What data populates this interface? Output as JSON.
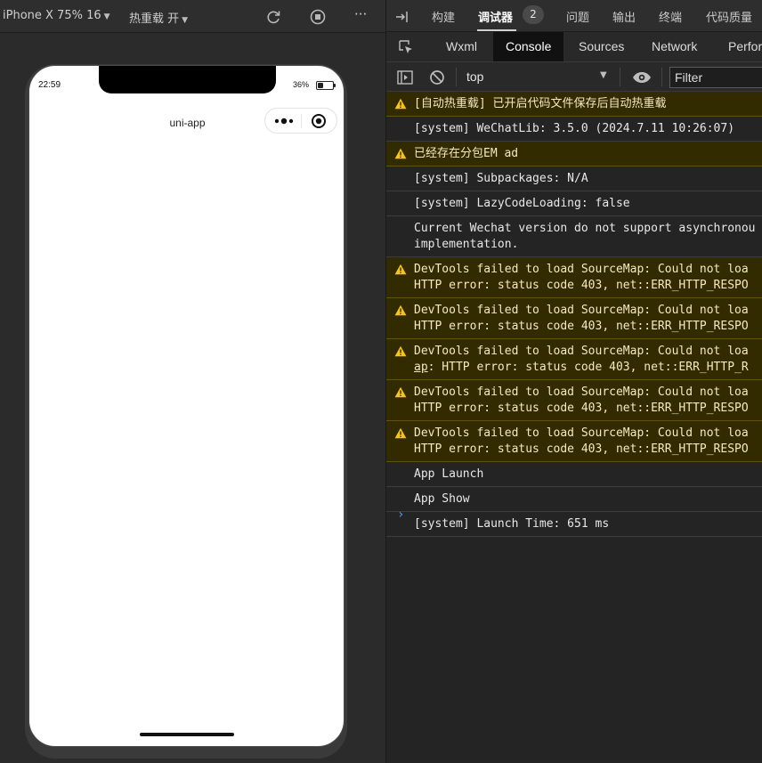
{
  "simulator": {
    "device_label": "iPhone X 75% 16",
    "hot_reload_label": "热重载 开",
    "toolbar_icons": [
      "refresh-icon",
      "stop-icon",
      "more-icon"
    ],
    "more_label": "···",
    "phone": {
      "time": "22:59",
      "battery_percent_text": "36%",
      "battery_level": 0.36,
      "nav_title": "uni-app"
    }
  },
  "devtools": {
    "top_tabs": [
      {
        "label": "构建",
        "active": false
      },
      {
        "label": "调试器",
        "active": true
      },
      {
        "label": "问题",
        "active": false
      },
      {
        "label": "输出",
        "active": false
      },
      {
        "label": "终端",
        "active": false
      },
      {
        "label": "代码质量",
        "active": false
      }
    ],
    "debugger_badge": "2",
    "panel_tabs": [
      {
        "label": "Wxml",
        "active": false
      },
      {
        "label": "Console",
        "active": true
      },
      {
        "label": "Sources",
        "active": false
      },
      {
        "label": "Network",
        "active": false
      },
      {
        "label": "Perfor",
        "active": false
      }
    ],
    "console_toolbar": {
      "context": "top",
      "filter_placeholder": "Filter"
    },
    "console_rows": [
      {
        "level": "warn",
        "lines": [
          "[自动热重载] 已开启代码文件保存后自动热重载"
        ]
      },
      {
        "level": "info",
        "lines": [
          "[system] WeChatLib: 3.5.0 (2024.7.11 10:26:07)"
        ]
      },
      {
        "level": "warn",
        "lines": [
          "已经存在分包EM ad"
        ]
      },
      {
        "level": "info",
        "lines": [
          "[system] Subpackages: N/A"
        ]
      },
      {
        "level": "info",
        "lines": [
          "[system] LazyCodeLoading: false"
        ]
      },
      {
        "level": "info",
        "lines": [
          "Current Wechat version do not support asynchronou",
          "implementation."
        ]
      },
      {
        "level": "warn",
        "lines": [
          "DevTools failed to load SourceMap: Could not loa",
          "HTTP error: status code 403, net::ERR_HTTP_RESPO"
        ]
      },
      {
        "level": "warn",
        "lines": [
          "DevTools failed to load SourceMap: Could not loa",
          "HTTP error: status code 403, net::ERR_HTTP_RESPO"
        ]
      },
      {
        "level": "warn",
        "lines": [
          "DevTools failed to load SourceMap: Could not loa",
          "ap: HTTP error: status code 403, net::ERR_HTTP_R"
        ],
        "underline_prefix": "ap"
      },
      {
        "level": "warn",
        "lines": [
          "DevTools failed to load SourceMap: Could not loa",
          "HTTP error: status code 403, net::ERR_HTTP_RESPO"
        ]
      },
      {
        "level": "warn",
        "lines": [
          "DevTools failed to load SourceMap: Could not loa",
          "HTTP error: status code 403, net::ERR_HTTP_RESPO"
        ]
      },
      {
        "level": "info",
        "lines": [
          "App Launch"
        ]
      },
      {
        "level": "info",
        "lines": [
          "App Show"
        ]
      },
      {
        "level": "info",
        "lines": [
          "[system] Launch Time: 651 ms"
        ]
      }
    ],
    "prompt_symbol": "›"
  },
  "colors": {
    "warn_bg": "#332b00",
    "warn_icon": "#f5c518",
    "active_panel_tab_bg": "#111111",
    "prompt": "#4f9cf4"
  }
}
